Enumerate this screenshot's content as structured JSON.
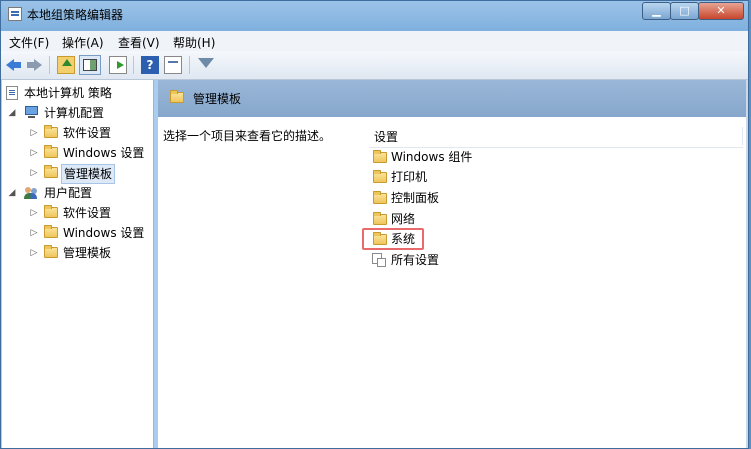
{
  "window": {
    "title": "本地组策略编辑器"
  },
  "menu": [
    {
      "label": "文件(F)"
    },
    {
      "label": "操作(A)"
    },
    {
      "label": "查看(V)"
    },
    {
      "label": "帮助(H)"
    }
  ],
  "toolbar": {
    "icons": [
      "back-arrow-icon",
      "forward-arrow-icon",
      "up-folder-icon",
      "show-hide-tree-icon",
      "export-list-icon",
      "help-icon",
      "properties-icon",
      "filter-icon"
    ]
  },
  "tree": {
    "root": "本地计算机 策略",
    "computer_config": "计算机配置",
    "computer_children": [
      "软件设置",
      "Windows 设置",
      "管理模板"
    ],
    "user_config": "用户配置",
    "user_children": [
      "软件设置",
      "Windows 设置",
      "管理模板"
    ],
    "selected": "管理模板"
  },
  "content": {
    "header_title": "管理模板",
    "description": "选择一个项目来查看它的描述。",
    "column_header": "设置",
    "items": [
      {
        "label": "Windows 组件",
        "icon": "folder-icon"
      },
      {
        "label": "打印机",
        "icon": "folder-icon"
      },
      {
        "label": "控制面板",
        "icon": "folder-icon"
      },
      {
        "label": "网络",
        "icon": "folder-icon"
      },
      {
        "label": "系统",
        "icon": "folder-icon",
        "highlighted": true
      },
      {
        "label": "所有设置",
        "icon": "all-settings-icon"
      }
    ],
    "highlight_color": "#e86a6a"
  },
  "colors": {
    "header_band": "#8fb0d3",
    "selection": "#dde9f7",
    "window_frame": "#7fb0de"
  }
}
